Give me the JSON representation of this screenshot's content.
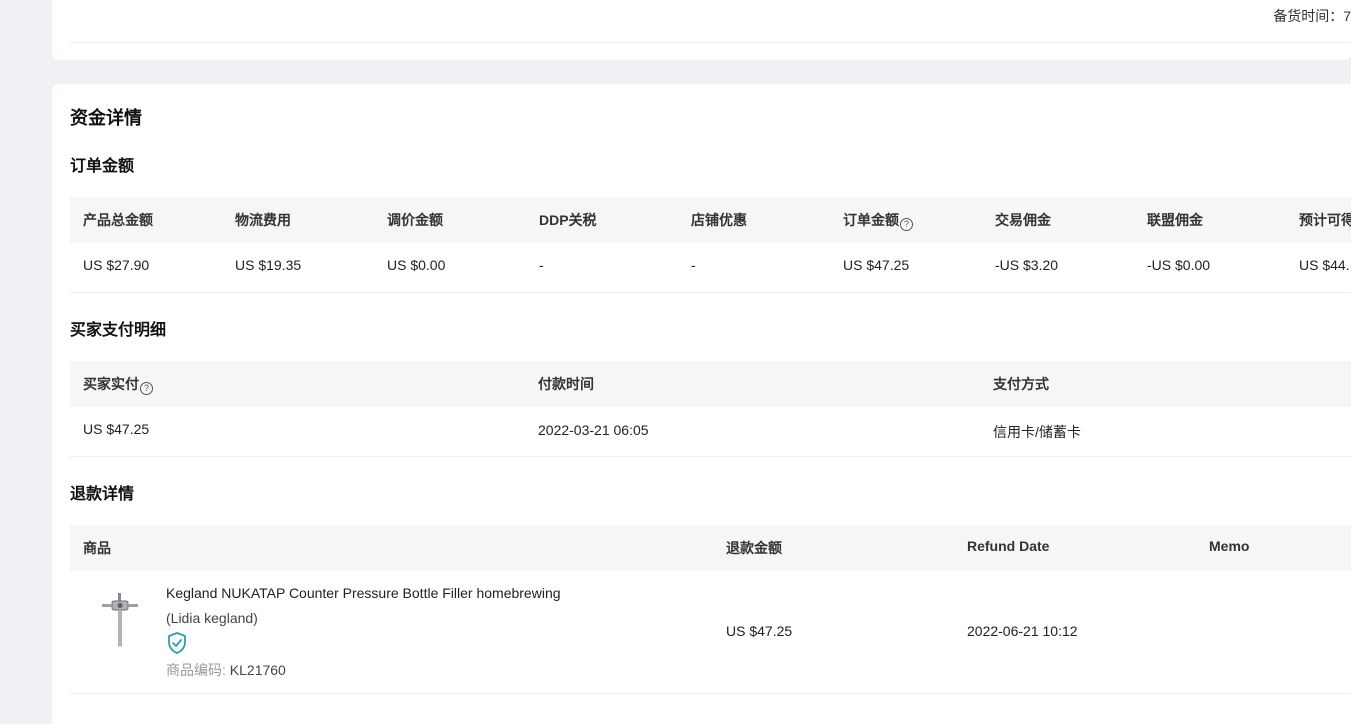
{
  "top": {
    "prep_time": "备货时间：7"
  },
  "funds": {
    "title": "资金详情",
    "order_amount": {
      "title": "订单金额",
      "headers": [
        "产品总金额",
        "物流费用",
        "调价金额",
        "DDP关税",
        "店铺优惠",
        "订单金额",
        "交易佣金",
        "联盟佣金",
        "预计可得"
      ],
      "values": [
        "US $27.90",
        "US $19.35",
        "US $0.00",
        "-",
        "-",
        "US $47.25",
        "-US $3.20",
        "-US $0.00",
        "US $44."
      ]
    },
    "buyer_payment": {
      "title": "买家支付明细",
      "headers": [
        "买家实付",
        "付款时间",
        "支付方式"
      ],
      "values": [
        "US $47.25",
        "2022-03-21 06:05",
        "信用卡/储蓄卡"
      ]
    },
    "refund": {
      "title": "退款详情",
      "headers": [
        "商品",
        "退款金额",
        "Refund Date",
        "Memo"
      ],
      "product": {
        "title": "Kegland NUKATAP Counter Pressure Bottle Filler homebrewing",
        "seller": "(Lidia kegland)",
        "code_label": "商品编码:",
        "code": "KL21760",
        "verified_icon": "shield-check-icon"
      },
      "amount": "US $47.25",
      "date": "2022-06-21 10:12",
      "memo": ""
    }
  },
  "colors": {
    "accent": "#2a9fb0",
    "header_bg": "#f5f6f8",
    "page_bg": "#f0f1f4"
  }
}
